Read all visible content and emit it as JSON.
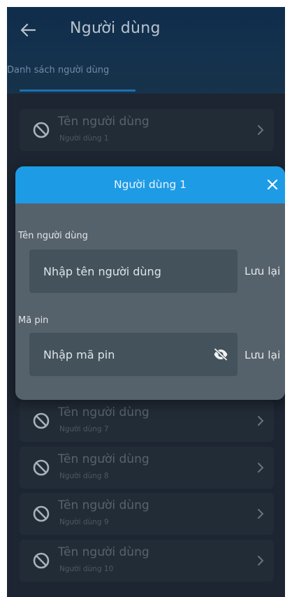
{
  "header": {
    "title": "Người dùng",
    "back_icon": "arrow-left-icon"
  },
  "tabs": [
    {
      "label": "Danh sách người dùng",
      "selected": true
    }
  ],
  "users": [
    {
      "title": "Tên người dùng",
      "subtitle": "Người dùng 1",
      "status_icon": "ban-icon"
    },
    {
      "title": "Tên người dùng",
      "subtitle": "Người dùng 7",
      "status_icon": "ban-icon"
    },
    {
      "title": "Tên người dùng",
      "subtitle": "Người dùng 8",
      "status_icon": "ban-icon"
    },
    {
      "title": "Tên người dùng",
      "subtitle": "Người dùng 9",
      "status_icon": "ban-icon"
    },
    {
      "title": "Tên người dùng",
      "subtitle": "Người dùng 10",
      "status_icon": "ban-icon"
    }
  ],
  "dialog": {
    "title": "Người dùng 1",
    "close_icon": "close-icon",
    "username": {
      "label": "Tên người dùng",
      "placeholder": "Nhập tên người dùng",
      "value": "",
      "save_label": "Lưu lại"
    },
    "pin": {
      "label": "Mã pin",
      "placeholder": "Nhập mã pin",
      "value": "",
      "visibility_icon": "eye-off-icon",
      "save_label": "Lưu lại"
    }
  },
  "colors": {
    "accent": "#1e9be5",
    "background": "#1c2530",
    "dialog_body": "#56626b",
    "input_bg": "#44525b"
  }
}
